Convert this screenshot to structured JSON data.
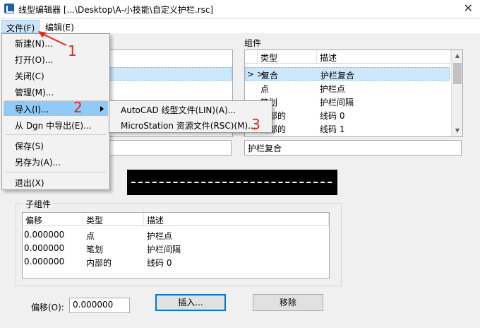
{
  "window": {
    "title": "线型编辑器 [...\\Desktop\\A-小技能\\自定义护栏.rsc]",
    "close_glyph": "✕"
  },
  "menubar": {
    "file": "文件(F)",
    "edit": "编辑(E)"
  },
  "file_menu": {
    "items": [
      "新建(N)...",
      "打开(O)...",
      "关闭(C)",
      "管理(M)...",
      "导入(I)...",
      "从 Dgn 中导出(E)...",
      "保存(S)",
      "另存为(A)...",
      "退出(X)"
    ]
  },
  "import_submenu": {
    "items": [
      "AutoCAD 线型文件(LIN)(A)...",
      "MicroStation 资源文件(RSC)(M)..."
    ]
  },
  "components": {
    "label": "组件",
    "headers": [
      "类型",
      "描述"
    ],
    "rows": [
      {
        "marker": "> >",
        "type": "复合",
        "desc": "护栏复合"
      },
      {
        "marker": "",
        "type": "点",
        "desc": "护栏点"
      },
      {
        "marker": "",
        "type": "笔划",
        "desc": "护栏间隔"
      },
      {
        "marker": "",
        "type": "内部的",
        "desc": "线码 0"
      },
      {
        "marker": "",
        "type": "内部的",
        "desc": "线码 1"
      }
    ],
    "desc_field": "护栏复合"
  },
  "subcomponents": {
    "label": "子组件",
    "headers": [
      "偏移",
      "类型",
      "描述"
    ],
    "rows": [
      {
        "offset": "0.000000",
        "type": "点",
        "desc": "护栏点"
      },
      {
        "offset": "0.000000",
        "type": "笔划",
        "desc": "护栏间隔"
      },
      {
        "offset": "0.000000",
        "type": "内部的",
        "desc": "线码 0"
      }
    ]
  },
  "offset": {
    "label": "偏移(O):",
    "value": "0.000000"
  },
  "buttons": {
    "insert": "插入...",
    "remove": "移除"
  },
  "annotations": {
    "step1": "1",
    "step2": "2",
    "step3": "3"
  },
  "colors": {
    "annotation_red": "#e5251a",
    "selection": "#cce8ff",
    "menu_hover": "#91c9f7"
  }
}
